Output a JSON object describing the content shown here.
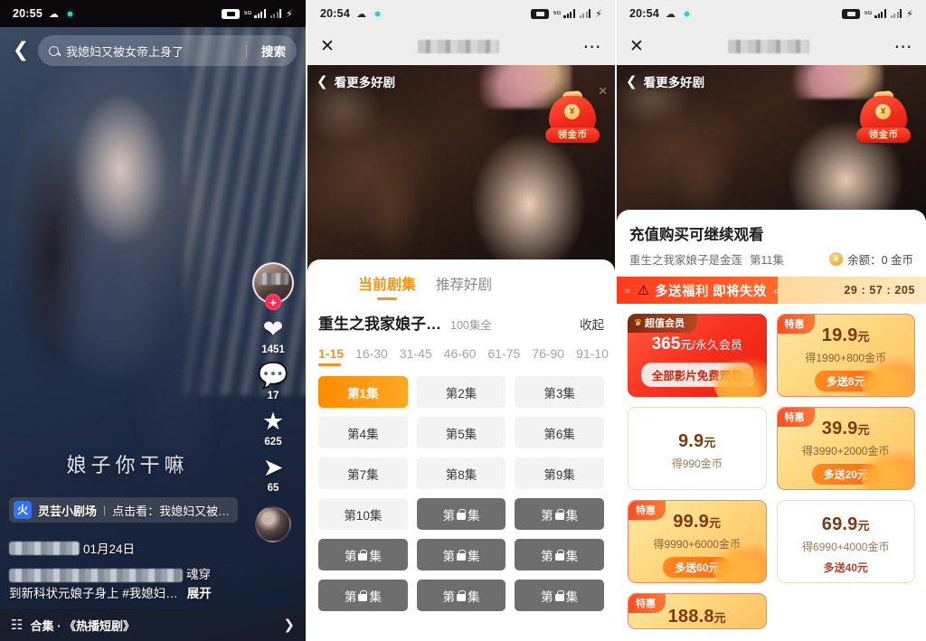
{
  "panel1": {
    "status": {
      "time": "20:55"
    },
    "search": {
      "query": "我媳妇又被女帝上身了",
      "button": "搜索",
      "back_icon": "chevron-left-icon"
    },
    "rail": {
      "like_count": "1451",
      "comment_count": "17",
      "favorite_count": "625",
      "share_count": "65"
    },
    "overlay_title": "娘子你干嘛",
    "promo_chip": {
      "icon_text": "火",
      "author": "灵芸小剧场",
      "separator": "|",
      "text": "点击看：我媳妇又被…"
    },
    "meta": {
      "date": "01月24日",
      "desc_line1": "魂穿",
      "desc_line2": "到新科状元娘子身上 #我媳妇…",
      "expand": "展开"
    },
    "bottom_bar": {
      "icon": "collection-stack-icon",
      "text": "合集 · 《热播短剧》",
      "arrow": "chevron-right-icon"
    }
  },
  "panel2": {
    "status": {
      "time": "20:54"
    },
    "webview": {
      "close_icon": "close-icon",
      "more_icon": "more-dots-icon"
    },
    "player": {
      "back_label": "看更多好剧",
      "coin_badge": "领金币",
      "coin_symbol": "¥"
    },
    "tabs": [
      {
        "label": "当前剧集",
        "active": true
      },
      {
        "label": "推荐好剧",
        "active": false
      }
    ],
    "series": {
      "name": "重生之我家娘子…",
      "count": "100集全",
      "collapse": "收起"
    },
    "ranges": [
      "1-15",
      "16-30",
      "31-45",
      "46-60",
      "61-75",
      "76-90",
      "91-10"
    ],
    "active_range": "1-15",
    "episodes": [
      {
        "label": "第1集",
        "state": "current"
      },
      {
        "label": "第2集",
        "state": "free"
      },
      {
        "label": "第3集",
        "state": "free"
      },
      {
        "label": "第4集",
        "state": "free"
      },
      {
        "label": "第5集",
        "state": "free"
      },
      {
        "label": "第6集",
        "state": "free"
      },
      {
        "label": "第7集",
        "state": "free"
      },
      {
        "label": "第8集",
        "state": "free"
      },
      {
        "label": "第9集",
        "state": "free"
      },
      {
        "label": "第10集",
        "state": "free"
      },
      {
        "label": "第集",
        "state": "locked"
      },
      {
        "label": "第集",
        "state": "locked"
      },
      {
        "label": "第集",
        "state": "locked"
      },
      {
        "label": "第集",
        "state": "locked"
      },
      {
        "label": "第集",
        "state": "locked"
      },
      {
        "label": "第集",
        "state": "locked"
      },
      {
        "label": "第集",
        "state": "locked"
      },
      {
        "label": "第集",
        "state": "locked"
      }
    ]
  },
  "panel3": {
    "status": {
      "time": "20:54"
    },
    "webview": {
      "close_icon": "close-icon",
      "more_icon": "more-dots-icon"
    },
    "player": {
      "back_label": "看更多好剧",
      "coin_badge": "领金币",
      "coin_symbol": "¥"
    },
    "paywall": {
      "title": "充值购买可继续观看",
      "drama": "重生之我家娘子是金莲",
      "episode": "第11集",
      "balance": "余额：0 金币",
      "coin_symbol": "¥",
      "banner_text": "多送福利 即将失效",
      "banner_warn_icon": "warning-icon",
      "timer": "29 : 57 : 205"
    },
    "packages": [
      {
        "kind": "vip",
        "ribbon": "超值会员",
        "price": "365",
        "unit": "元/永久会员",
        "pill": "全部影片免费观看"
      },
      {
        "kind": "hl",
        "ribbon": "特惠",
        "price": "19.9",
        "unit": "元",
        "gain": "得1990+800金币",
        "bonus": "多送8元"
      },
      {
        "kind": "plain",
        "ribbon": "",
        "price": "9.9",
        "unit": "元",
        "gain": "得990金币",
        "bonus": ""
      },
      {
        "kind": "hl",
        "ribbon": "特惠",
        "price": "39.9",
        "unit": "元",
        "gain": "得3990+2000金币",
        "bonus": "多送20元"
      },
      {
        "kind": "hl",
        "ribbon": "特惠",
        "price": "99.9",
        "unit": "元",
        "gain": "得9990+6000金币",
        "bonus": "多送60元"
      },
      {
        "kind": "plain",
        "ribbon": "",
        "price": "69.9",
        "unit": "元",
        "gain": "得6990+4000金币",
        "bonus": "多送40元"
      },
      {
        "kind": "hl-cut",
        "ribbon": "特惠",
        "price": "188.8",
        "unit": "元",
        "gain": "",
        "bonus": ""
      }
    ]
  }
}
